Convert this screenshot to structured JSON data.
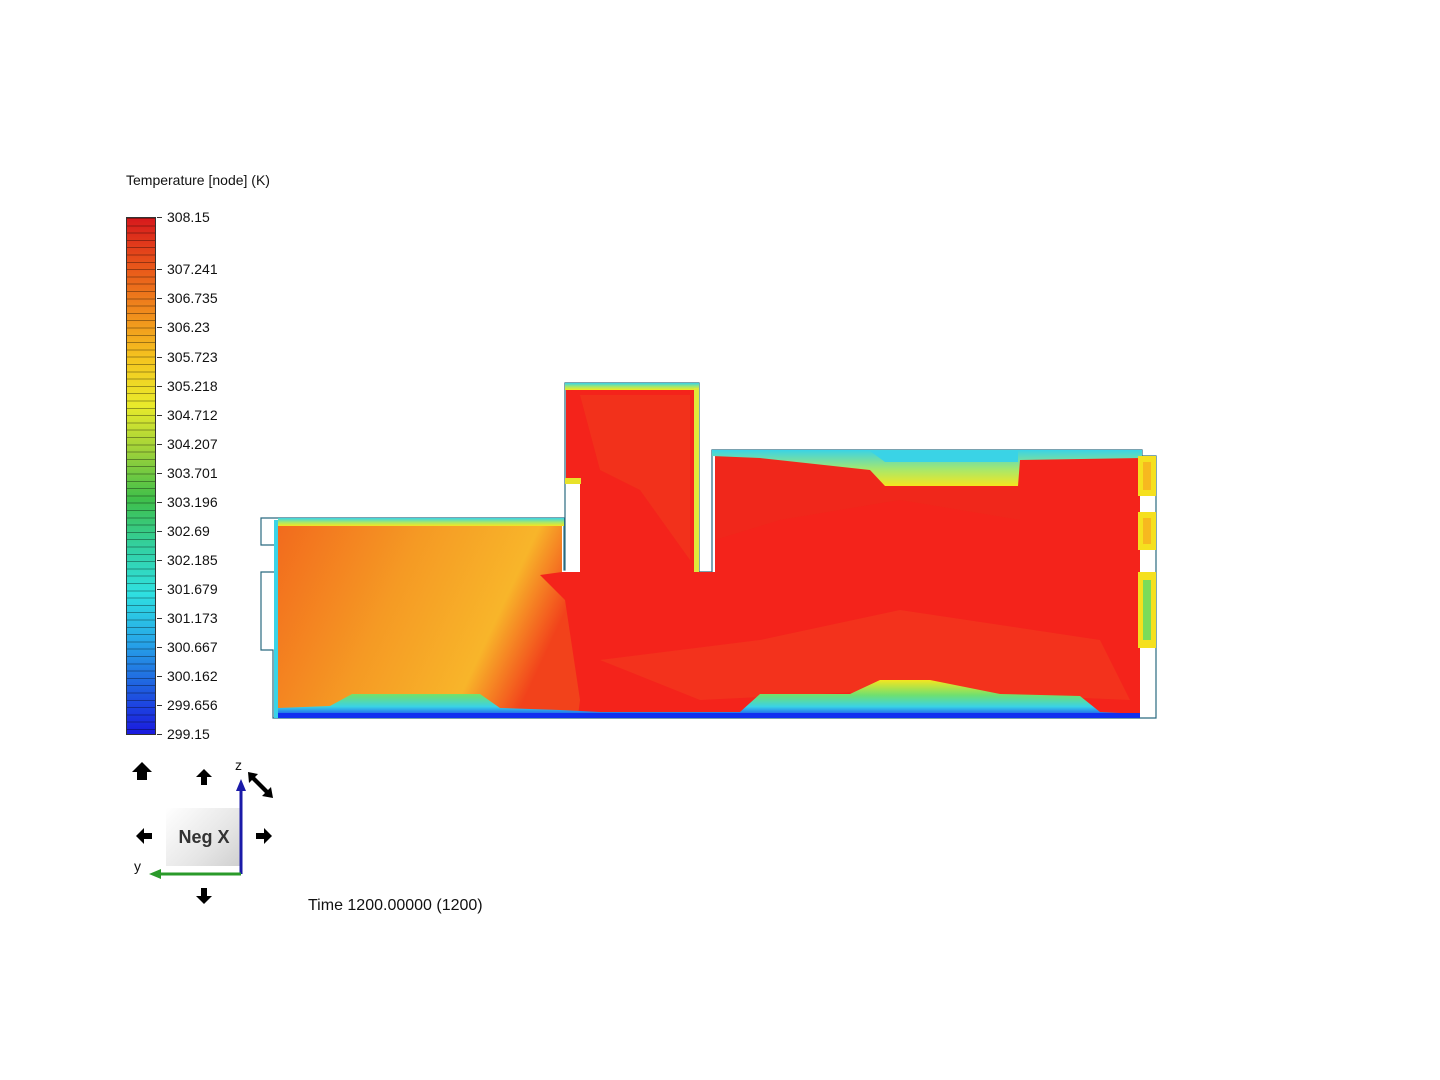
{
  "legend": {
    "title": "Temperature [node] (K)",
    "ticks": [
      "308.15",
      "307.241",
      "306.735",
      "306.23",
      "305.723",
      "305.218",
      "304.712",
      "304.207",
      "303.701",
      "303.196",
      "302.69",
      "302.185",
      "301.679",
      "301.173",
      "300.667",
      "300.162",
      "299.656",
      "299.15"
    ],
    "colors": [
      "#d7191c",
      "#e8541a",
      "#f08a1c",
      "#f5c51f",
      "#e9ea2b",
      "#9bd13a",
      "#3fbf4a",
      "#33d0a0",
      "#2fe0e0",
      "#27a8e8",
      "#1f5fe0",
      "#1a1adf"
    ]
  },
  "view": {
    "cube_label": "Neg X",
    "axis_z": "z",
    "axis_y": "y",
    "icons": [
      "home-icon",
      "rotate-up-icon",
      "rotate-down-icon",
      "rotate-left-icon",
      "rotate-right-icon",
      "roll-icon"
    ]
  },
  "time_label": "Time 1200.00000 (1200)",
  "field_colors": {
    "hot": "#f4231b",
    "warm": "#f2601d",
    "mid": "#f8b52a",
    "cool": "#3ad3e6",
    "cold": "#1030f0",
    "outline": "#2a6a80"
  }
}
